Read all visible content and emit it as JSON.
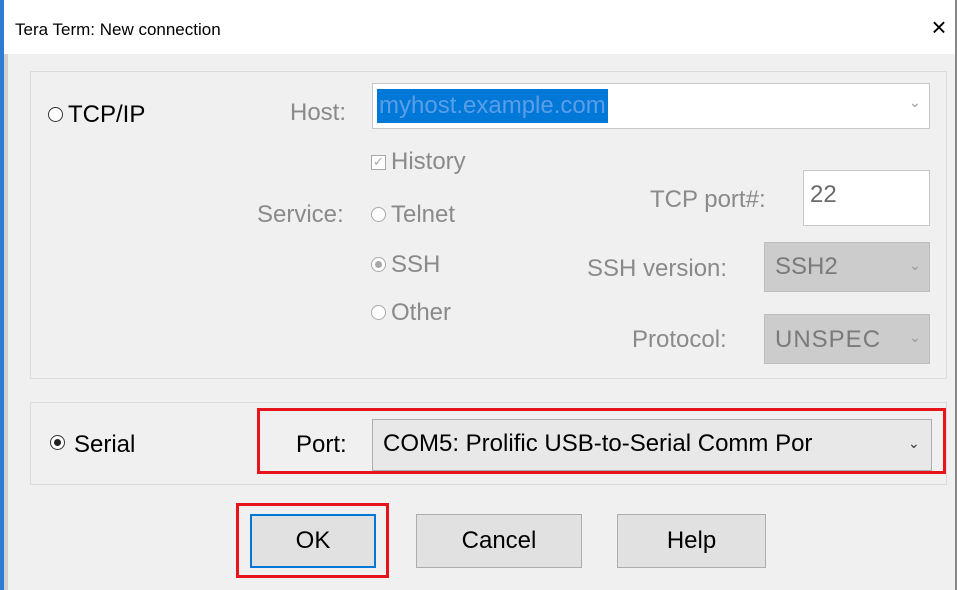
{
  "window": {
    "title": "Tera Term: New connection",
    "close_icon": "×"
  },
  "tcpip": {
    "radio_label": "TCP/IP",
    "selected": false,
    "host_label": "Host:",
    "host_value": "myhost.example.com",
    "history_label": "History",
    "history_checked": true,
    "service_label": "Service:",
    "services": [
      "Telnet",
      "SSH",
      "Other"
    ],
    "service_selected": "SSH",
    "tcp_port_label": "TCP port#:",
    "tcp_port_value": "22",
    "ssh_version_label": "SSH version:",
    "ssh_version_value": "SSH2",
    "protocol_label": "Protocol:",
    "protocol_value": "UNSPEC"
  },
  "serial": {
    "radio_label": "Serial",
    "selected": true,
    "port_label": "Port:",
    "port_value": "COM5: Prolific USB-to-Serial Comm Por"
  },
  "buttons": {
    "ok": "OK",
    "cancel": "Cancel",
    "help": "Help"
  },
  "colors": {
    "highlight_red": "#e8141c",
    "focus_blue": "#0078d7",
    "dialog_bg": "#f0f0f0"
  }
}
